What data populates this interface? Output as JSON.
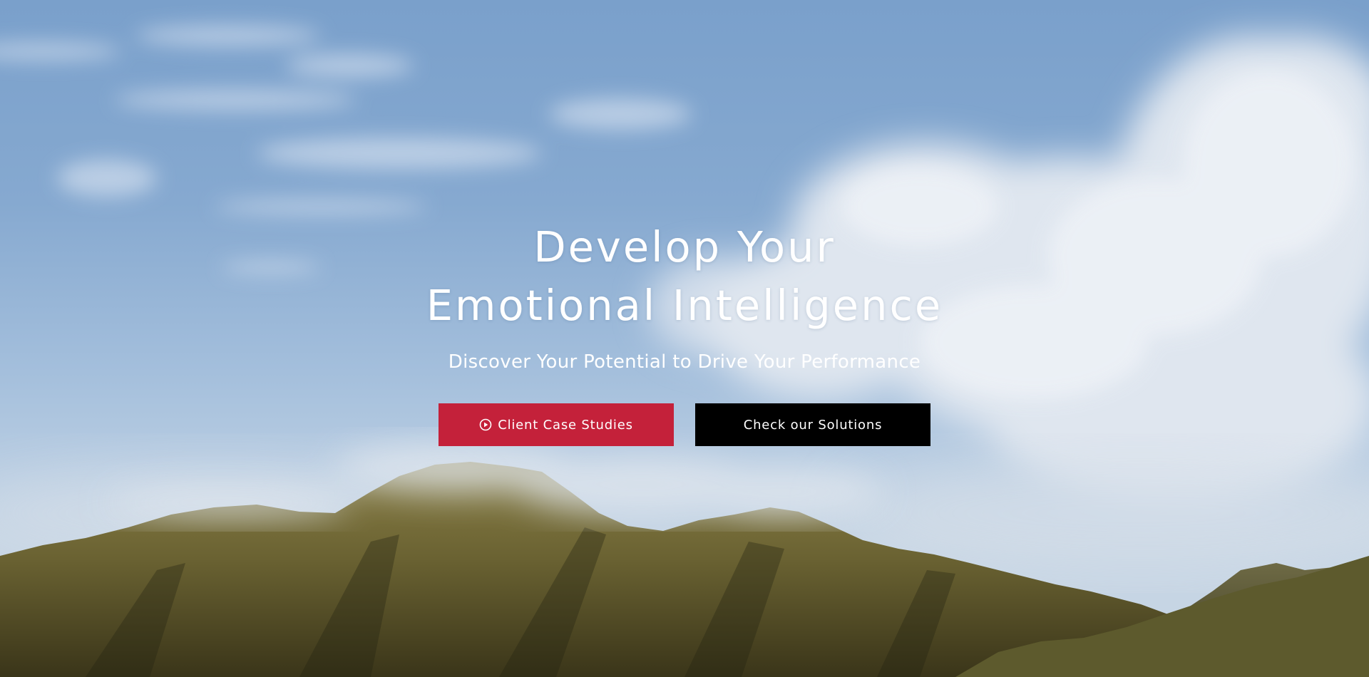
{
  "hero": {
    "headline_line1": "Develop Your",
    "headline_line2": "Emotional Intelligence",
    "subheadline": "Discover Your Potential to Drive Your Performance"
  },
  "buttons": {
    "primary_label": "Client Case Studies",
    "primary_icon": "play-circle-icon",
    "primary_color": "#c4213a",
    "secondary_label": "Check our Solutions",
    "secondary_color": "#000000"
  }
}
